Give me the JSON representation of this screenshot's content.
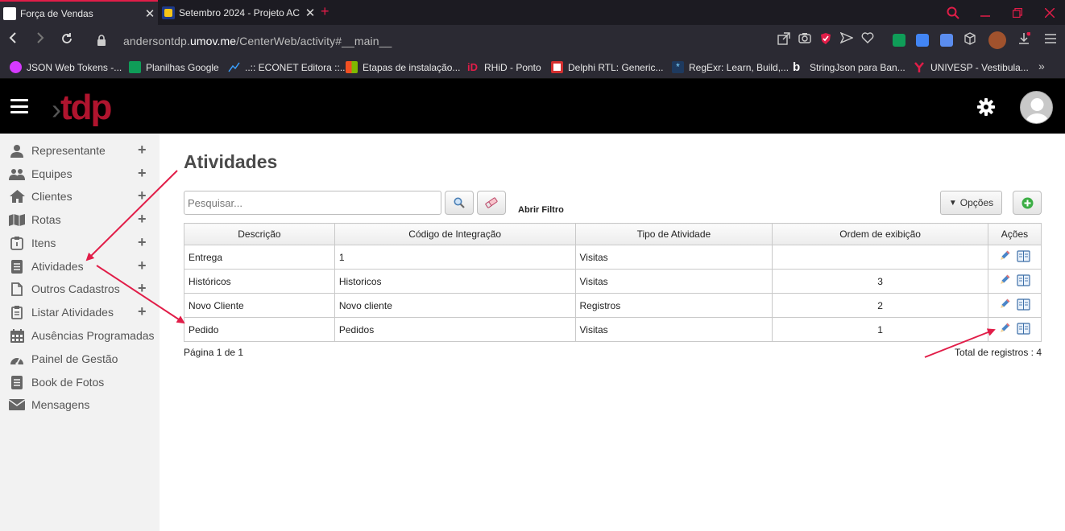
{
  "browser": {
    "tabs": [
      {
        "title": "Força de Vendas",
        "active": true
      },
      {
        "title": "Setembro 2024 - Projeto AC",
        "active": false
      }
    ],
    "url_prefix": "andersontdp.",
    "url_domain": "umov.me",
    "url_path": "/CenterWeb/activity#__main__",
    "bookmarks": [
      "JSON Web Tokens -...",
      "Planilhas Google",
      "..:: ECONET Editora ::..",
      "Etapas de instalação...",
      "RHiD - Ponto",
      "Delphi RTL: Generic...",
      "RegExr: Learn, Build,...",
      "StringJson para Ban...",
      "UNIVESP - Vestibula..."
    ]
  },
  "app": {
    "logo": "tdp",
    "accent": "#b0142e"
  },
  "sidebar": {
    "items": [
      {
        "label": "Representante",
        "icon": "user-icon",
        "expandable": true
      },
      {
        "label": "Equipes",
        "icon": "users-icon",
        "expandable": true
      },
      {
        "label": "Clientes",
        "icon": "home-icon",
        "expandable": true
      },
      {
        "label": "Rotas",
        "icon": "map-icon",
        "expandable": true
      },
      {
        "label": "Itens",
        "icon": "box-icon",
        "expandable": true
      },
      {
        "label": "Atividades",
        "icon": "list-icon",
        "expandable": true
      },
      {
        "label": "Outros Cadastros",
        "icon": "file-icon",
        "expandable": true
      },
      {
        "label": "Listar Atividades",
        "icon": "clipboard-icon",
        "expandable": true
      },
      {
        "label": "Ausências Programadas",
        "icon": "calendar-icon",
        "expandable": false
      },
      {
        "label": "Painel de Gestão",
        "icon": "dashboard-icon",
        "expandable": false
      },
      {
        "label": "Book de Fotos",
        "icon": "book-icon",
        "expandable": false
      },
      {
        "label": "Mensagens",
        "icon": "mail-icon",
        "expandable": false
      }
    ]
  },
  "main": {
    "title": "Atividades",
    "search_placeholder": "Pesquisar...",
    "open_filter": "Abrir Filtro",
    "options_label": "Opções",
    "columns": [
      "Descrição",
      "Código de Integração",
      "Tipo de Atividade",
      "Ordem de exibição",
      "Ações"
    ],
    "rows": [
      {
        "descricao": "Entrega",
        "codigo": "1",
        "tipo": "Visitas",
        "ordem": ""
      },
      {
        "descricao": "Históricos",
        "codigo": "Historicos",
        "tipo": "Visitas",
        "ordem": "3"
      },
      {
        "descricao": "Novo Cliente",
        "codigo": "Novo cliente",
        "tipo": "Registros",
        "ordem": "2"
      },
      {
        "descricao": "Pedido",
        "codigo": "Pedidos",
        "tipo": "Visitas",
        "ordem": "1"
      }
    ],
    "pagination": "Página 1 de 1",
    "total": "Total de registros : 4"
  },
  "annotation_color": "#e11d48"
}
